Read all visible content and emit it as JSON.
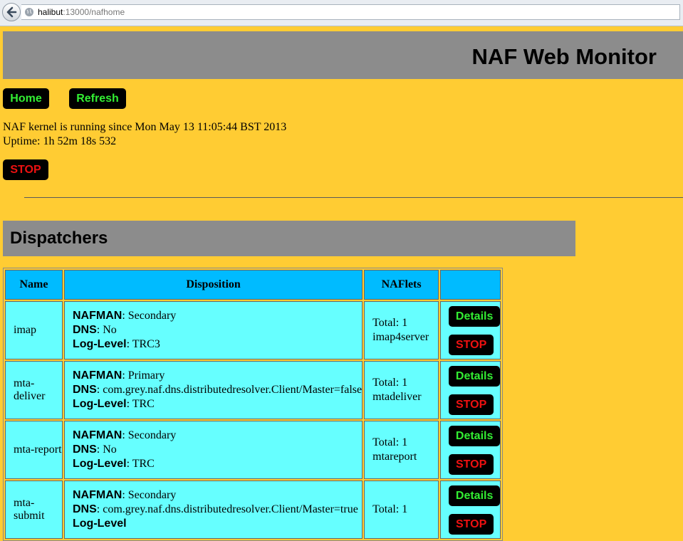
{
  "browser": {
    "url_host": "halibut",
    "url_rest": ":13000/nafhome"
  },
  "header": {
    "title": "NAF Web Monitor"
  },
  "nav": {
    "home_label": "Home",
    "refresh_label": "Refresh"
  },
  "status": {
    "running_line": "NAF kernel is running since Mon May 13 11:05:44 BST 2013",
    "uptime_line": "Uptime: 1h 52m 18s 532",
    "stop_label": "STOP"
  },
  "dispatchers": {
    "title": "Dispatchers",
    "columns": [
      "Name",
      "Disposition",
      "NAFlets",
      ""
    ],
    "rows": [
      {
        "name": "imap",
        "nafman_key": "NAFMAN",
        "nafman": ": Secondary",
        "dns_key": "DNS",
        "dns": ": No",
        "log_key": "Log-Level",
        "log": ": TRC3",
        "total": "Total: 1",
        "naflet": "imap4server",
        "details_label": "Details",
        "stop_label": "STOP"
      },
      {
        "name": "mta-deliver",
        "nafman_key": "NAFMAN",
        "nafman": ": Primary",
        "dns_key": "DNS",
        "dns": ": com.grey.naf.dns.distributedresolver.Client/Master=false",
        "log_key": "Log-Level",
        "log": ": TRC",
        "total": "Total: 1",
        "naflet": "mtadeliver",
        "details_label": "Details",
        "stop_label": "STOP"
      },
      {
        "name": "mta-report",
        "nafman_key": "NAFMAN",
        "nafman": ": Secondary",
        "dns_key": "DNS",
        "dns": ": No",
        "log_key": "Log-Level",
        "log": ": TRC",
        "total": "Total: 1",
        "naflet": "mtareport",
        "details_label": "Details",
        "stop_label": "STOP"
      },
      {
        "name": "mta-submit",
        "nafman_key": "NAFMAN",
        "nafman": ": Secondary",
        "dns_key": "DNS",
        "dns": ": com.grey.naf.dns.distributedresolver.Client/Master=true",
        "log_key": "Log-Level",
        "log": "",
        "total": "Total: 1",
        "naflet": "",
        "details_label": "Details",
        "stop_label": "STOP"
      }
    ]
  },
  "colors": {
    "page_bg": "#ffcc33",
    "header_bg": "#8c8c8c",
    "th_bg": "#00bbff",
    "td_bg": "#66ffff",
    "btn_green_text": "#33ee33",
    "btn_red_text": "#ee1111"
  }
}
